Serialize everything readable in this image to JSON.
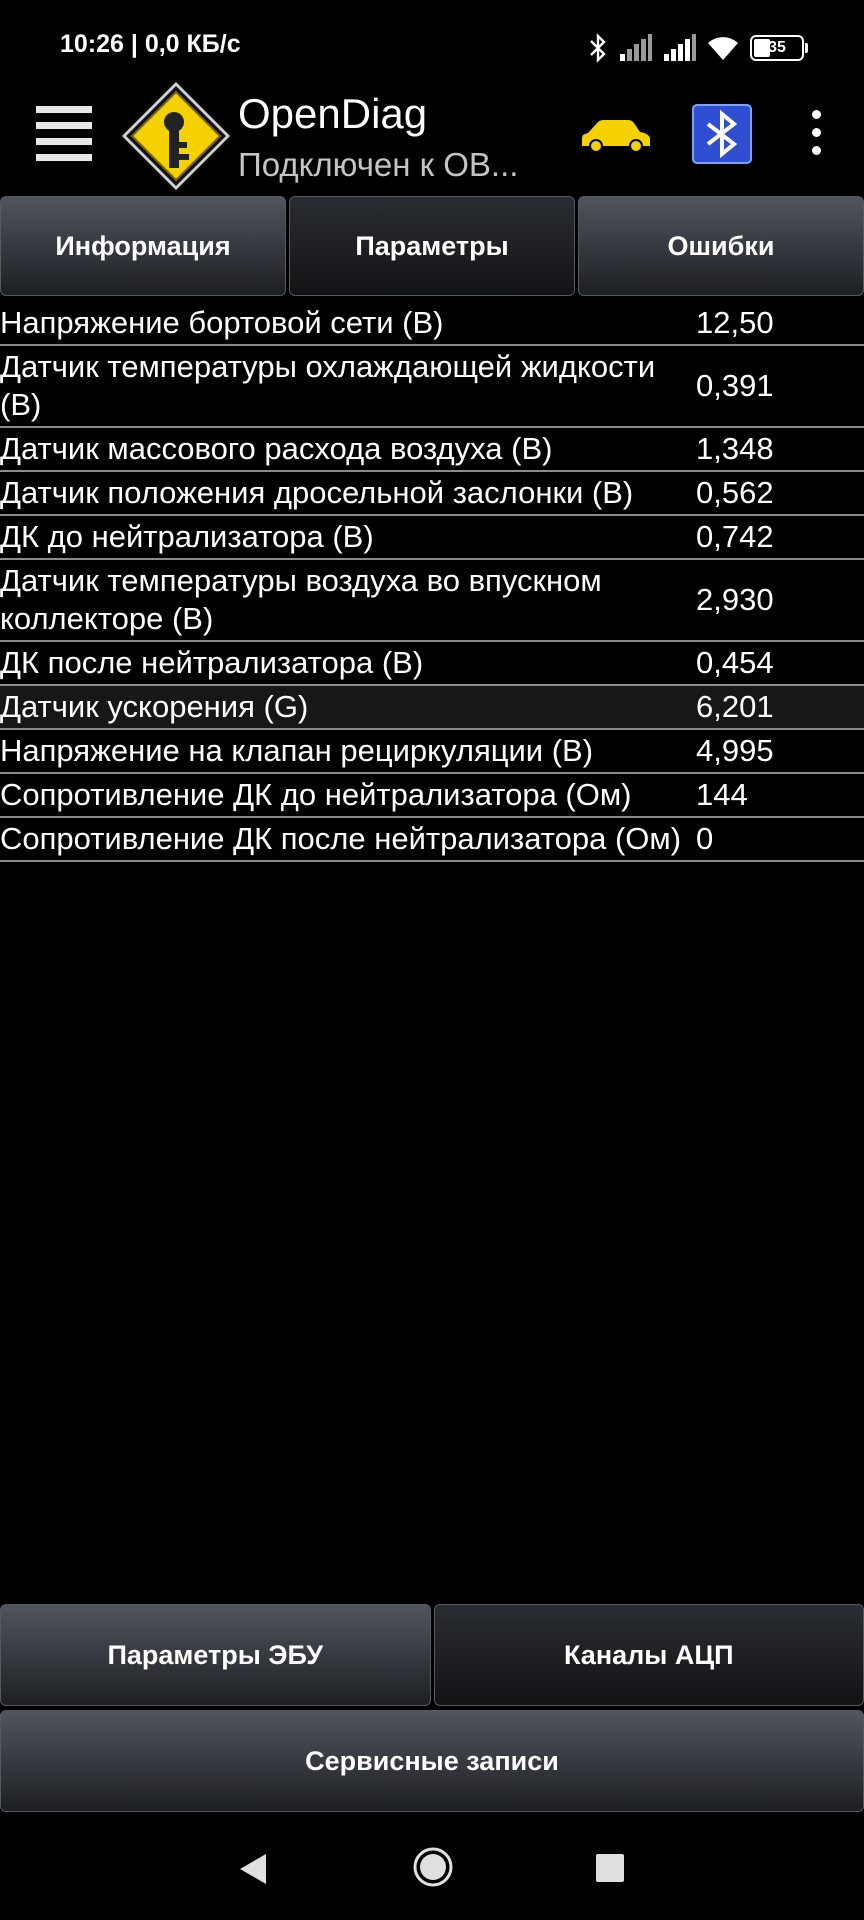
{
  "status_bar": {
    "time": "10:26 | 0,0 КБ/с",
    "battery_level": "35",
    "icons": [
      "bluetooth-icon",
      "signal-icon",
      "signal-icon",
      "wifi-icon",
      "battery-icon"
    ]
  },
  "app_bar": {
    "title": "OpenDiag",
    "subtitle": "Подключен к ОВ...",
    "icons": [
      "menu-icon",
      "app-logo-icon",
      "car-icon",
      "bluetooth-adapter-icon",
      "more-options-icon"
    ],
    "accent_color": "#f5d100"
  },
  "tabs": [
    {
      "label": "Информация",
      "active": false
    },
    {
      "label": "Параметры",
      "active": true
    },
    {
      "label": "Ошибки",
      "active": false
    }
  ],
  "parameters": [
    {
      "label": "Напряжение бортовой сети (В)",
      "value": "12,50"
    },
    {
      "label": "Датчик температуры охлаждающей жидкости (В)",
      "value": "0,391"
    },
    {
      "label": "Датчик массового расхода воздуха (В)",
      "value": "1,348"
    },
    {
      "label": "Датчик положения дросельной заслонки (В)",
      "value": "0,562"
    },
    {
      "label": "ДК до нейтрализатора (В)",
      "value": "0,742"
    },
    {
      "label": "Датчик температуры воздуха во впускном коллекторе (В)",
      "value": "2,930"
    },
    {
      "label": "ДК после нейтрализатора (В)",
      "value": "0,454"
    },
    {
      "label": "Датчик ускорения (G)",
      "value": "6,201"
    },
    {
      "label": "Напряжение на клапан рециркуляции (В)",
      "value": "4,995"
    },
    {
      "label": "Сопротивление ДК до нейтрализатора (Ом)",
      "value": "144"
    },
    {
      "label": "Сопротивление ДК после нейтрализатора (Ом)",
      "value": "0"
    }
  ],
  "bottom_buttons": {
    "ecu_params": "Параметры ЭБУ",
    "adc_channels": "Каналы АЦП",
    "service_records": "Сервисные записи"
  },
  "nav_bar": {
    "icons": [
      "back-icon",
      "home-icon",
      "recents-icon"
    ]
  }
}
